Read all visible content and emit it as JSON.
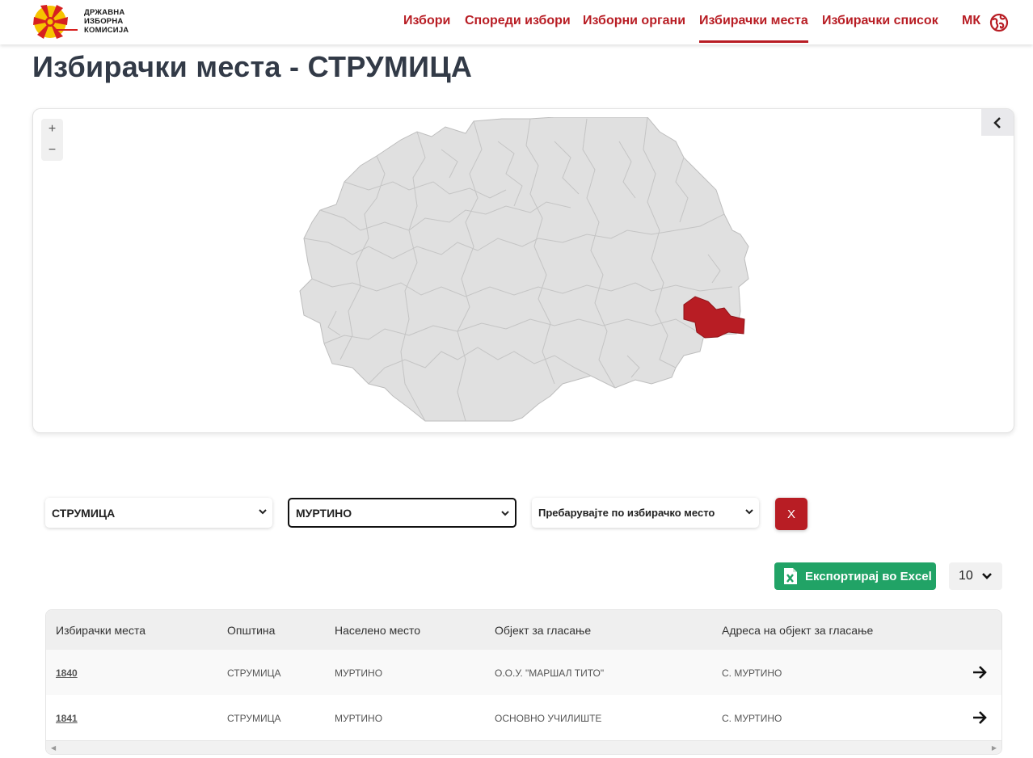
{
  "brand": {
    "logo_text_line1": "ДРЖАВНА",
    "logo_text_line2": "ИЗБОРНА",
    "logo_text_line3": "КОМИСИЈА",
    "accent_color": "#b81d24"
  },
  "nav": {
    "items": [
      {
        "label": "Избори"
      },
      {
        "label": "Спореди избори"
      },
      {
        "label": "Изборни органи"
      },
      {
        "label": "Избирачки места",
        "active": true
      },
      {
        "label": "Избирачки список"
      }
    ],
    "language": "МК",
    "language_icon": "globe-icon"
  },
  "page": {
    "title": "Избирачки места - СТРУМИЦА"
  },
  "map": {
    "zoom_in": "+",
    "zoom_out": "−",
    "collapse_icon": "chevron-left-icon",
    "highlight_color": "#b81d24",
    "base_color": "#e0e0e0"
  },
  "filters": {
    "municipality": "СТРУМИЦА",
    "settlement": "МУРТИНО",
    "polling_station_placeholder": "Пребарувајте по избирачко место",
    "clear_label": "X"
  },
  "actions": {
    "export_label": "Експортирај во Excel",
    "export_icon": "excel-icon",
    "page_size": "10"
  },
  "table": {
    "headers": [
      "Избирачки места",
      "Општина",
      "Населено место",
      "Објект за гласање",
      "Адреса на објект за гласање"
    ],
    "rows": [
      {
        "station": "1840",
        "municipality": "СТРУМИЦА",
        "settlement": "МУРТИНО",
        "object": "О.О.У. \"МАРШАЛ ТИТО\"",
        "address": "С. МУРТИНО"
      },
      {
        "station": "1841",
        "municipality": "СТРУМИЦА",
        "settlement": "МУРТИНО",
        "object": "ОСНОВНО УЧИЛИШТЕ",
        "address": "С. МУРТИНО"
      }
    ]
  }
}
